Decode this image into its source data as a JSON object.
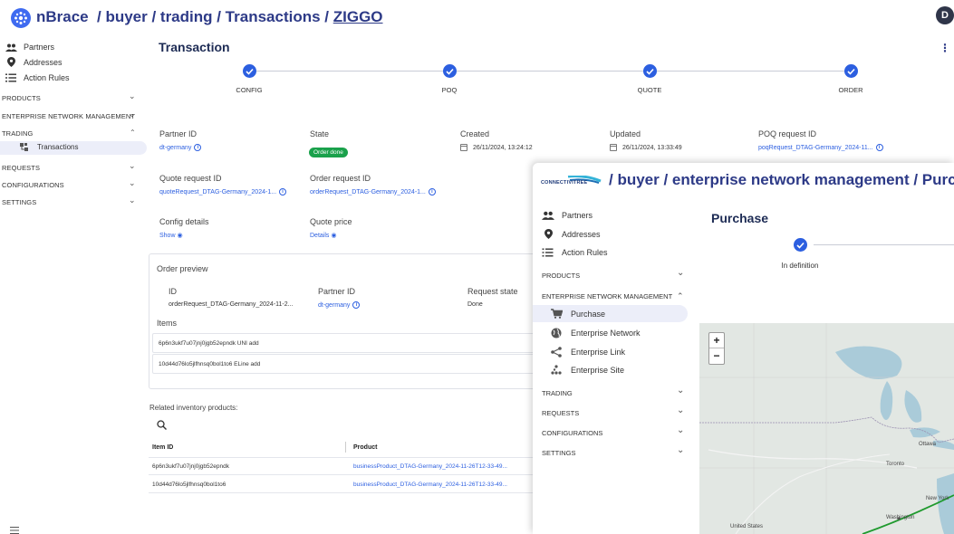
{
  "header": {
    "brand": "nBrace",
    "breadcrumb": " / buyer / trading / Transactions / ",
    "breadcrumb_link": "ZIGGO",
    "avatar_initial": "D"
  },
  "sidebar": {
    "items": [
      {
        "label": "Partners",
        "icon": "partners-icon"
      },
      {
        "label": "Addresses",
        "icon": "location-pin-icon"
      },
      {
        "label": "Action Rules",
        "icon": "list-icon"
      }
    ],
    "sections": [
      {
        "label": "PRODUCTS",
        "expanded": false
      },
      {
        "label": "ENTERPRISE NETWORK MANAGEMENT",
        "expanded": false
      },
      {
        "label": "TRADING",
        "expanded": true
      },
      {
        "label": "REQUESTS",
        "expanded": false
      },
      {
        "label": "CONFIGURATIONS",
        "expanded": false
      },
      {
        "label": "SETTINGS",
        "expanded": false
      }
    ],
    "trading_child": "Transactions"
  },
  "main": {
    "title": "Transaction",
    "steps": [
      "CONFIG",
      "POQ",
      "QUOTE",
      "ORDER"
    ],
    "fields": {
      "partner_id_label": "Partner ID",
      "partner_id_value": "dt-germany",
      "state_label": "State",
      "state_value": "Order done",
      "created_label": "Created",
      "created_value": "26/11/2024, 13:24:12",
      "updated_label": "Updated",
      "updated_value": "26/11/2024, 13:33:49",
      "poq_label": "POQ request ID",
      "poq_value": "poqRequest_DTAG-Germany_2024-11...",
      "quote_label": "Quote request ID",
      "quote_value": "quoteRequest_DTAG-Germany_2024-1...",
      "order_label": "Order request ID",
      "order_value": "orderRequest_DTAG-Germany_2024-1...",
      "config_label": "Config details",
      "config_value": "Show",
      "price_label": "Quote price",
      "price_value": "Details"
    },
    "order_preview": {
      "title": "Order preview",
      "id_label": "ID",
      "id_value": "orderRequest_DTAG-Germany_2024-11-2...",
      "partner_label": "Partner ID",
      "partner_value": "dt-germany",
      "state_label": "Request state",
      "state_value": "Done",
      "items_label": "Items",
      "items": [
        "6p6n3ukf7u07jnj0jgb52epndk UNI add",
        "10d44d76lo5jlfhnsq0bol1to6 ELine add"
      ]
    },
    "inventory": {
      "title": "Related inventory products:",
      "columns": [
        "Item ID",
        "Product"
      ],
      "rows": [
        [
          "6p6n3ukf7u07jnj0jgb52epndk",
          "businessProduct_DTAG-Germany_2024-11-26T12-33-49..."
        ],
        [
          "10d44d76lo5jlfhnsq0bol1to6",
          "businessProduct_DTAG-Germany_2024-11-26T12-33-49..."
        ]
      ]
    }
  },
  "overlay": {
    "logo_text": "CONNECTIVITREE",
    "breadcrumb": "/ buyer / enterprise network management / Purchase",
    "items": [
      {
        "label": "Partners",
        "icon": "partners-icon"
      },
      {
        "label": "Addresses",
        "icon": "location-pin-icon"
      },
      {
        "label": "Action Rules",
        "icon": "list-icon"
      }
    ],
    "sections": {
      "products": "PRODUCTS",
      "enm": "ENTERPRISE NETWORK MANAGEMENT",
      "trading": "TRADING",
      "requests": "REQUESTS",
      "configurations": "CONFIGURATIONS",
      "settings": "SETTINGS"
    },
    "enm_children": [
      {
        "label": "Purchase",
        "icon": "cart-icon"
      },
      {
        "label": "Enterprise Network",
        "icon": "globe-icon"
      },
      {
        "label": "Enterprise Link",
        "icon": "share-icon"
      },
      {
        "label": "Enterprise Site",
        "icon": "dots-icon"
      }
    ],
    "title": "Purchase",
    "step_label": "In definition",
    "map": {
      "zoom_in": "+",
      "zoom_out": "−",
      "labels": [
        "Ottawa",
        "Toronto",
        "New York",
        "Washington",
        "United States"
      ]
    }
  },
  "colors": {
    "accent": "#2c5fe0",
    "brand": "#2d3a87",
    "success": "#1aa14b"
  }
}
